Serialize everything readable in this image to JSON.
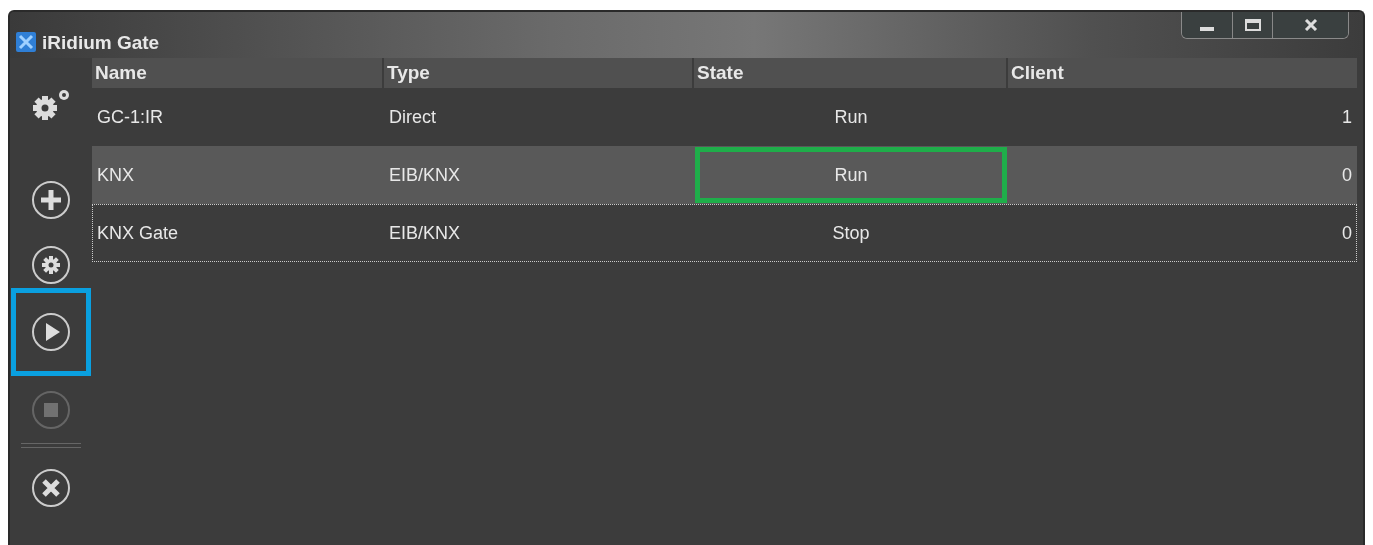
{
  "window": {
    "title": "iRidium Gate",
    "controls": [
      {
        "kind": "minimize"
      },
      {
        "kind": "maximize"
      },
      {
        "kind": "close"
      }
    ]
  },
  "sidebar": {
    "buttons": [
      {
        "kind": "add",
        "disabled": false,
        "highlighted": false
      },
      {
        "kind": "settings",
        "disabled": false,
        "highlighted": false
      },
      {
        "kind": "play",
        "disabled": false,
        "highlighted": true
      },
      {
        "kind": "stop",
        "disabled": true,
        "highlighted": false
      },
      {
        "kind": "divider"
      },
      {
        "kind": "remove",
        "disabled": false,
        "highlighted": false
      }
    ]
  },
  "table": {
    "columns": [
      "Name",
      "Type",
      "State",
      "Client"
    ],
    "rows": [
      {
        "name": "GC-1:IR",
        "type": "Direct",
        "state": "Run",
        "client": "1",
        "selected": false,
        "focused": false,
        "state_highlighted": false
      },
      {
        "name": "KNX",
        "type": "EIB/KNX",
        "state": "Run",
        "client": "0",
        "selected": true,
        "focused": false,
        "state_highlighted": true
      },
      {
        "name": "KNX Gate",
        "type": "EIB/KNX",
        "state": "Stop",
        "client": "0",
        "selected": false,
        "focused": true,
        "state_highlighted": false
      }
    ]
  }
}
